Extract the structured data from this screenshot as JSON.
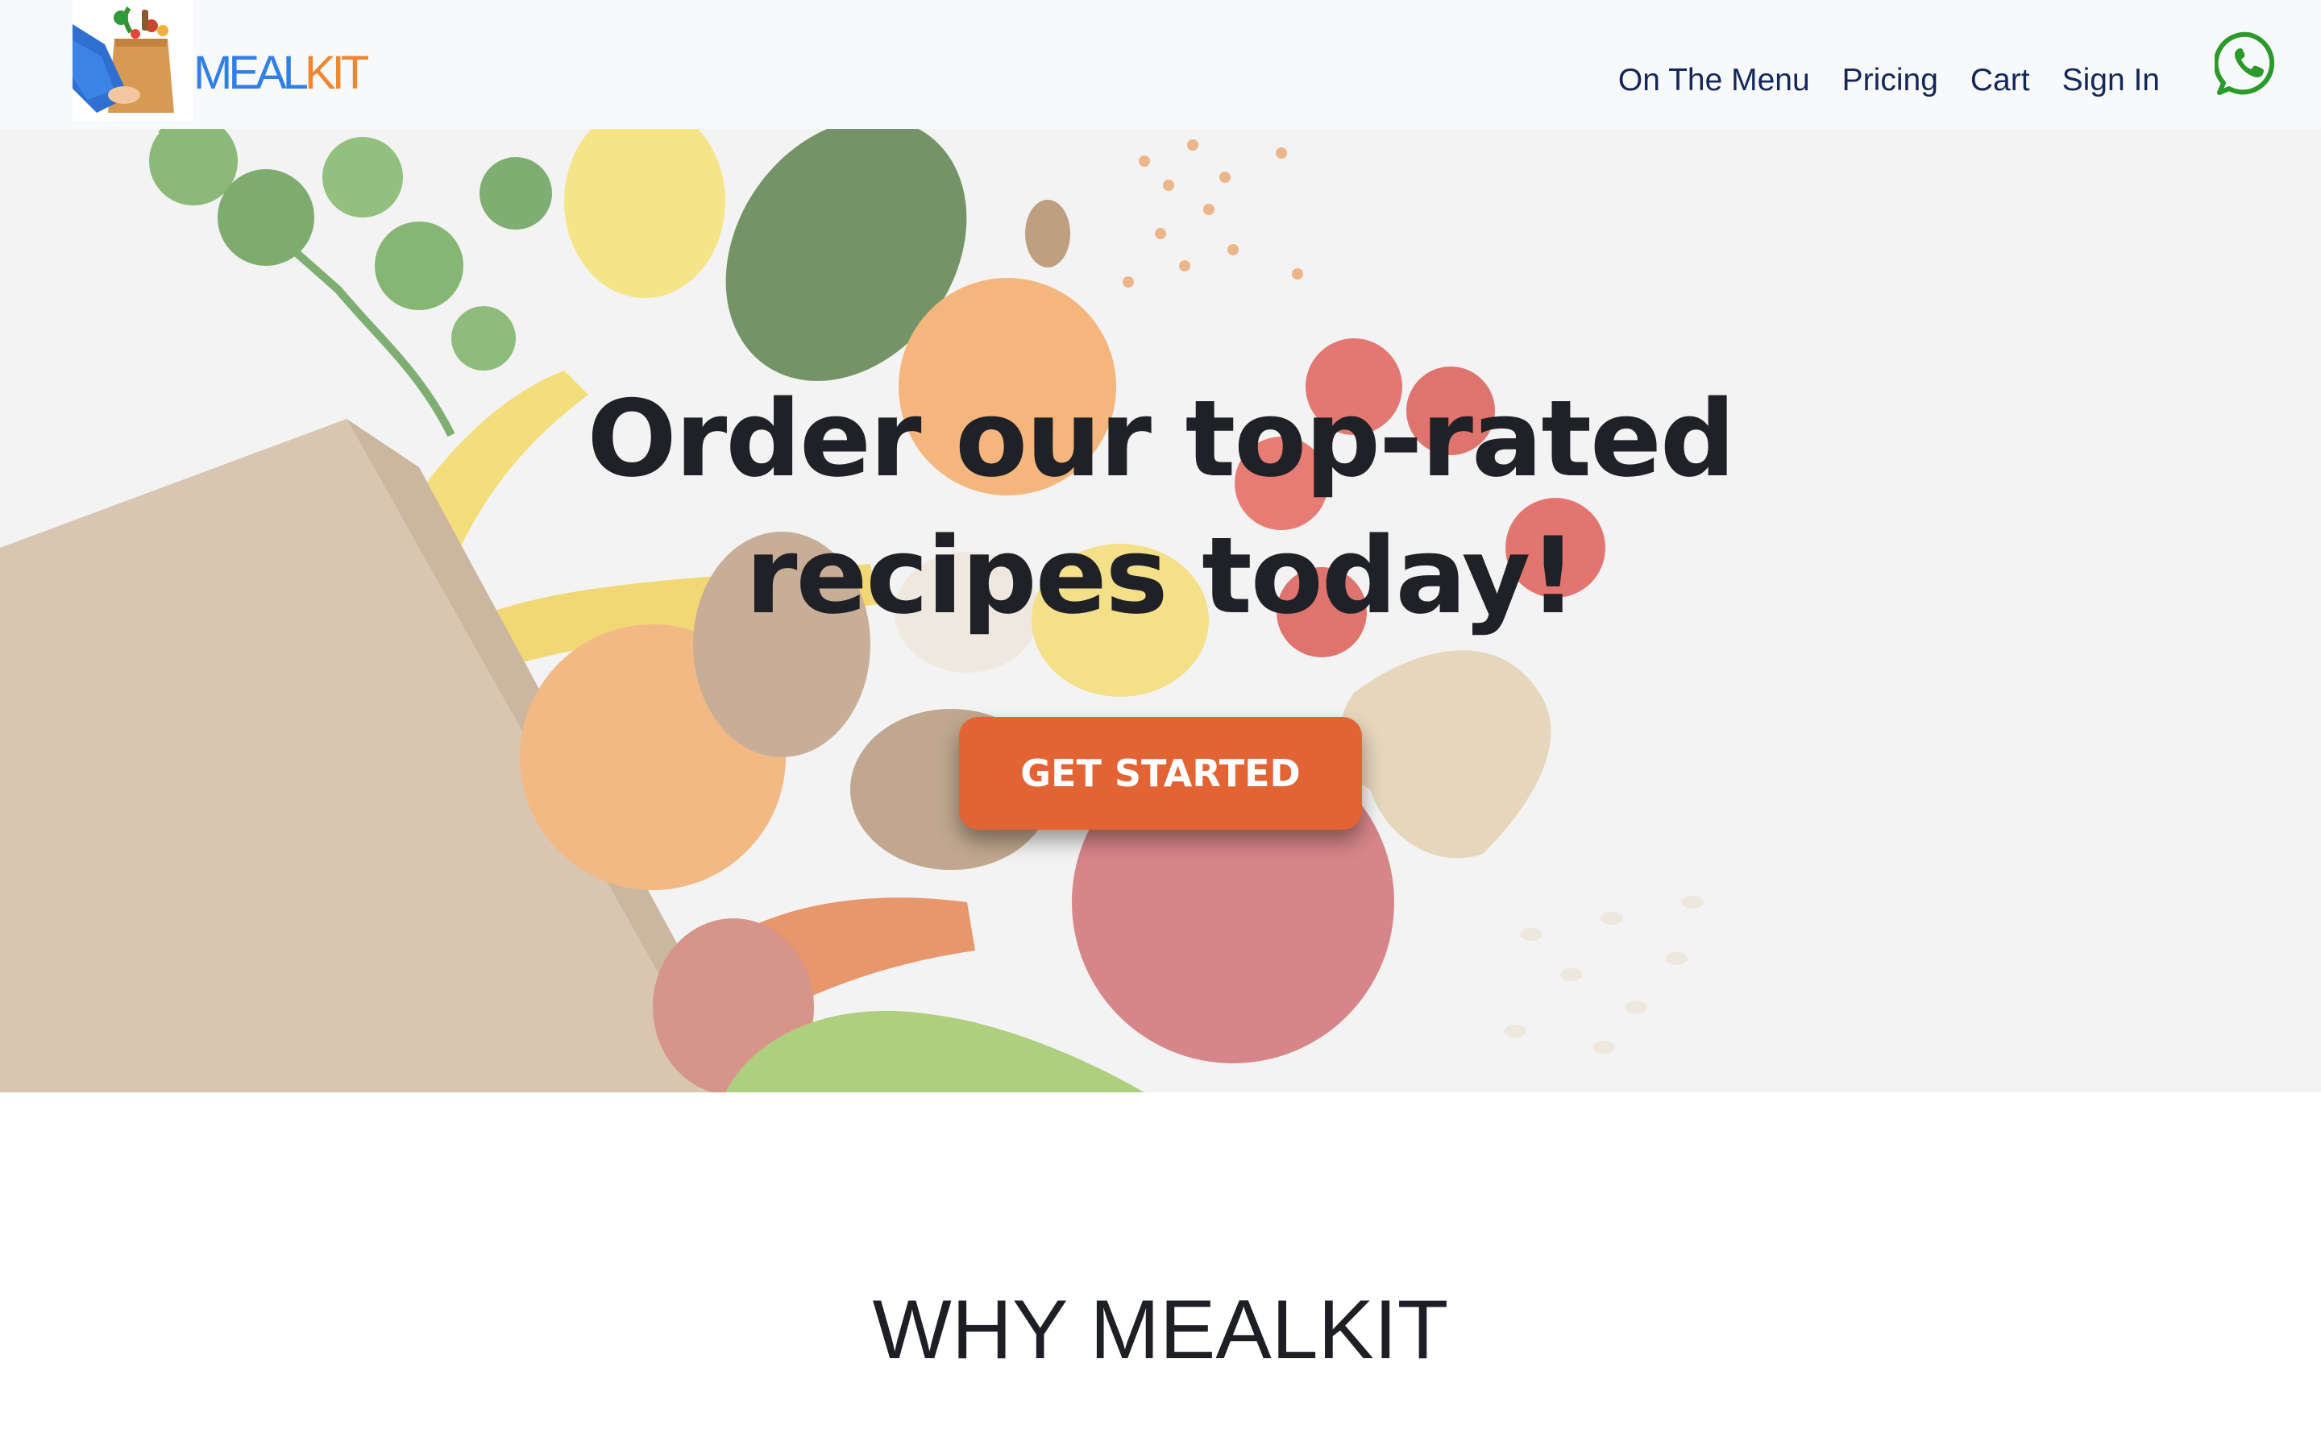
{
  "brand": {
    "word_part1": "MEAL",
    "word_part2": "KIT",
    "colors": {
      "part1": "#2f7fe8",
      "part2": "#ef8630"
    },
    "logo_icon": "grocery-bag-icon"
  },
  "nav": {
    "items": [
      {
        "label": "On The Menu"
      },
      {
        "label": "Pricing"
      },
      {
        "label": "Cart"
      },
      {
        "label": "Sign In"
      }
    ],
    "contact_icon": "whatsapp-icon",
    "text_color": "#14275a"
  },
  "hero": {
    "title_line1": "Order our top-rated",
    "title_line2": "recipes today!",
    "cta_label": "GET STARTED",
    "cta_color": "#e26434",
    "background_image": "groceries-spilling-from-paper-bag"
  },
  "why": {
    "title": "WHY MEALKIT"
  }
}
